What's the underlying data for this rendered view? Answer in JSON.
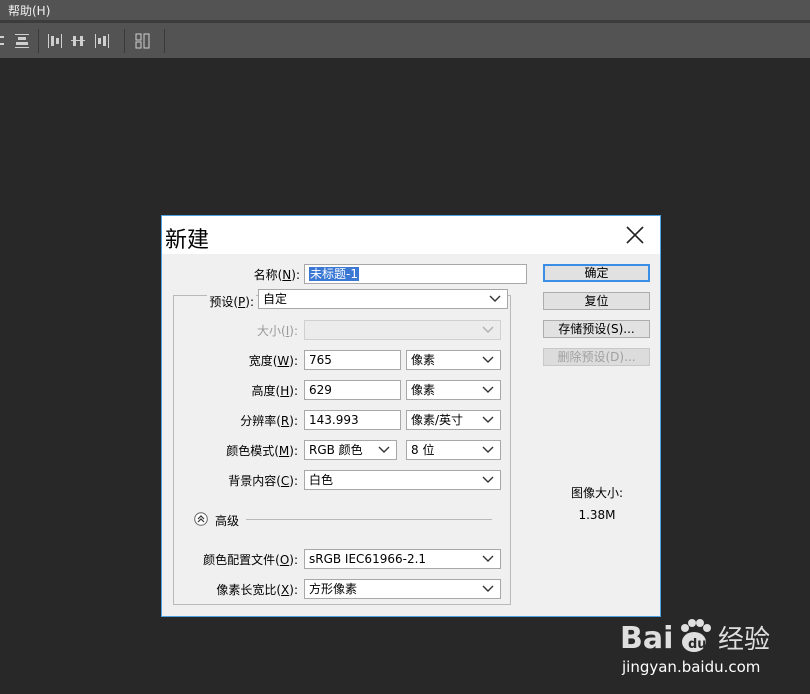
{
  "menubar": {
    "help_label": "帮助(H)"
  },
  "dialog": {
    "title": "新建",
    "name_label": "名称(",
    "name_key": "N",
    "name_label_end": "):",
    "name_value": "未标题-1",
    "preset_label": "预设(",
    "preset_key": "P",
    "preset_label_end": "):",
    "preset_value": "自定",
    "size_label": "大小(",
    "size_key": "I",
    "size_label_end": "):",
    "size_value": "",
    "width_label": "宽度(",
    "width_key": "W",
    "width_label_end": "):",
    "width_value": "765",
    "width_unit": "像素",
    "height_label": "高度(",
    "height_key": "H",
    "height_label_end": "):",
    "height_value": "629",
    "height_unit": "像素",
    "resolution_label": "分辨率(",
    "resolution_key": "R",
    "resolution_label_end": "):",
    "resolution_value": "143.993",
    "resolution_unit": "像素/英寸",
    "colormode_label": "颜色模式(",
    "colormode_key": "M",
    "colormode_label_end": "):",
    "colormode_value": "RGB 颜色",
    "bitdepth_value": "8 位",
    "background_label": "背景内容(",
    "background_key": "C",
    "background_label_end": "):",
    "background_value": "白色",
    "advanced_label": "高级",
    "profile_label": "颜色配置文件(",
    "profile_key": "O",
    "profile_label_end": "):",
    "profile_value": "sRGB IEC61966-2.1",
    "aspect_label": "像素长宽比(",
    "aspect_key": "X",
    "aspect_label_end": "):",
    "aspect_value": "方形像素",
    "ok_label": "确定",
    "reset_label": "复位",
    "save_preset_label": "存储预设(S)...",
    "delete_preset_label": "删除预设(D)...",
    "image_size_label": "图像大小:",
    "image_size_value": "1.38M"
  },
  "watermark": {
    "domain": "jingyan.baidu.com"
  },
  "colors": {
    "workspace": "#282828",
    "chrome": "#535353",
    "dialog_bg": "#f0f0f0",
    "dialog_border": "#4fa2e0",
    "selection": "#3a78d4",
    "primary_button_border": "#3a8ee6"
  }
}
